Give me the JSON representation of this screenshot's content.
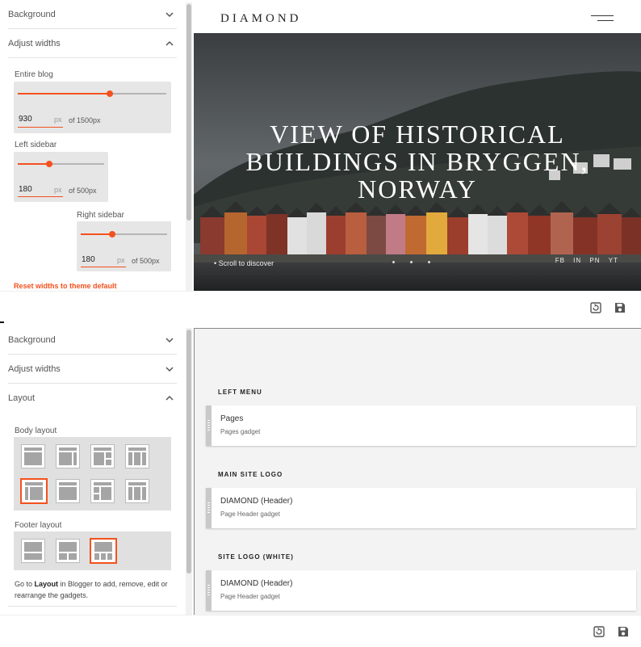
{
  "top": {
    "sections": {
      "background": "Background",
      "adjust_widths": "Adjust widths"
    },
    "sliders": [
      {
        "label": "Entire blog",
        "value": "930",
        "unit": "px",
        "of": "of 1500px",
        "fraction": 0.62
      },
      {
        "label": "Left sidebar",
        "value": "180",
        "unit": "px",
        "of": "of 500px",
        "fraction": 0.36
      },
      {
        "label": "Right sidebar",
        "value": "180",
        "unit": "px",
        "of": "of 500px",
        "fraction": 0.36
      }
    ],
    "reset_label": "Reset widths to theme default",
    "preview": {
      "brand": "DIAMOND",
      "hero_title_line1": "View of historical",
      "hero_title_line2": "buildings in Bryggen,",
      "hero_title_line3": "Norway",
      "scroll_text": "Scroll to discover",
      "social": [
        "FB",
        "IN",
        "PN",
        "YT"
      ]
    }
  },
  "bottom": {
    "sections": {
      "background": "Background",
      "adjust_widths": "Adjust widths",
      "layout": "Layout"
    },
    "body_layout_label": "Body layout",
    "footer_layout_label": "Footer layout",
    "note_prefix": "Go to ",
    "note_bold": "Layout",
    "note_suffix": " in Blogger to add, remove, edit or rearrange the gadgets.",
    "gadget_sections": [
      {
        "heading": "LEFT MENU",
        "title": "Pages",
        "subtitle": "Pages gadget"
      },
      {
        "heading": "MAIN SITE LOGO",
        "title": "DIAMOND (Header)",
        "subtitle": "Page Header gadget"
      },
      {
        "heading": "SITE LOGO (WHITE)",
        "title": "DIAMOND (Header)",
        "subtitle": "Page Header gadget"
      }
    ]
  },
  "icons": {
    "chevron_down": "chevron-down-icon",
    "chevron_up": "chevron-up-icon",
    "revert": "revert-icon",
    "save": "save-icon"
  },
  "colors": {
    "accent": "#f4511e"
  }
}
